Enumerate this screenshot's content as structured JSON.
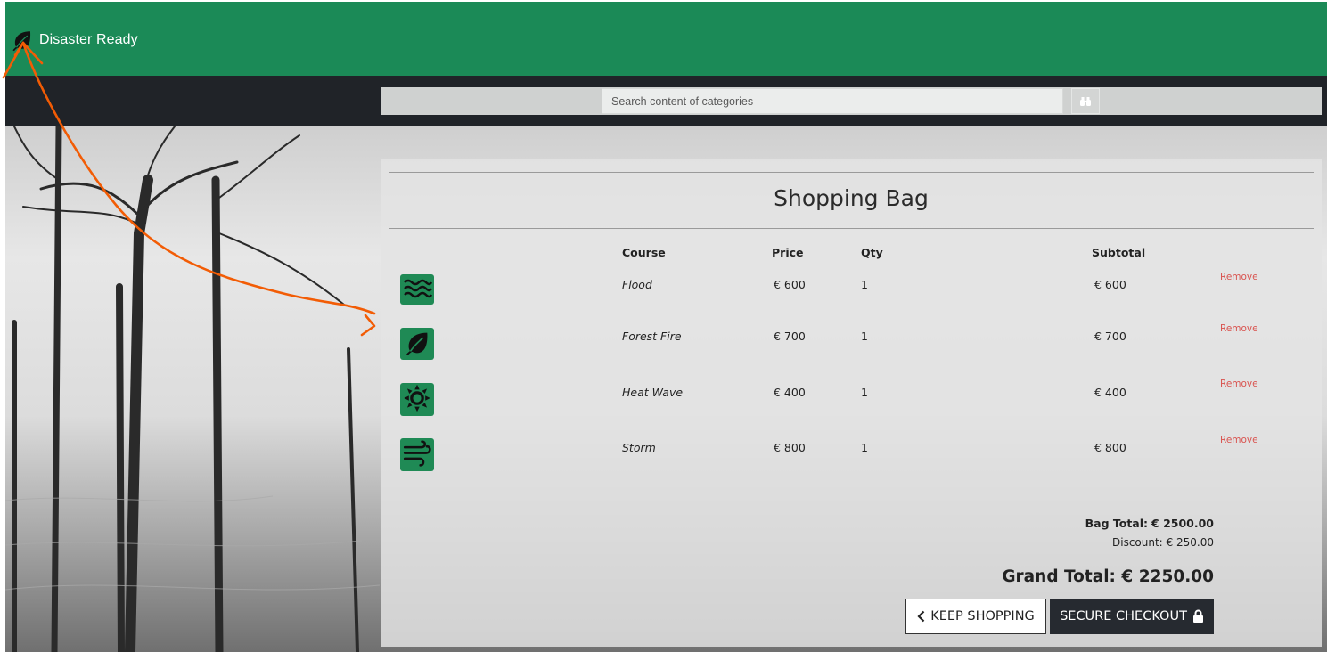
{
  "brand": {
    "name": "Disaster Ready",
    "icon": "leaf-icon"
  },
  "search": {
    "placeholder": "Search content of categories",
    "button_icon": "binoculars-icon"
  },
  "bag": {
    "title": "Shopping Bag",
    "columns": {
      "course": "Course",
      "price": "Price",
      "qty": "Qty",
      "subtotal": "Subtotal"
    },
    "items": [
      {
        "icon": "flood-waves-icon",
        "name": "Flood",
        "price": "€ 600",
        "qty": "1",
        "subtotal": "€ 600",
        "remove": "Remove"
      },
      {
        "icon": "leaf-icon",
        "name": "Forest Fire",
        "price": "€ 700",
        "qty": "1",
        "subtotal": "€ 700",
        "remove": "Remove"
      },
      {
        "icon": "sun-icon",
        "name": "Heat Wave",
        "price": "€ 400",
        "qty": "1",
        "subtotal": "€ 400",
        "remove": "Remove"
      },
      {
        "icon": "wind-icon",
        "name": "Storm",
        "price": "€ 800",
        "qty": "1",
        "subtotal": "€ 800",
        "remove": "Remove"
      }
    ],
    "totals": {
      "bag_label": "Bag Total:",
      "bag_value": "€ 2500.00",
      "discount_label": "Discount:",
      "discount_value": "€ 250.00",
      "grand_label": "Grand Total:",
      "grand_value": "€ 2250.00"
    },
    "keep_shopping": "KEEP SHOPPING",
    "secure_checkout": "SECURE CHECKOUT"
  },
  "colors": {
    "header": "#1b8a57",
    "nav": "#202328",
    "icon_bg": "#1f8a55",
    "remove": "#d9534f",
    "annotation": "#f25c05",
    "checkout_bg": "#262a30"
  }
}
